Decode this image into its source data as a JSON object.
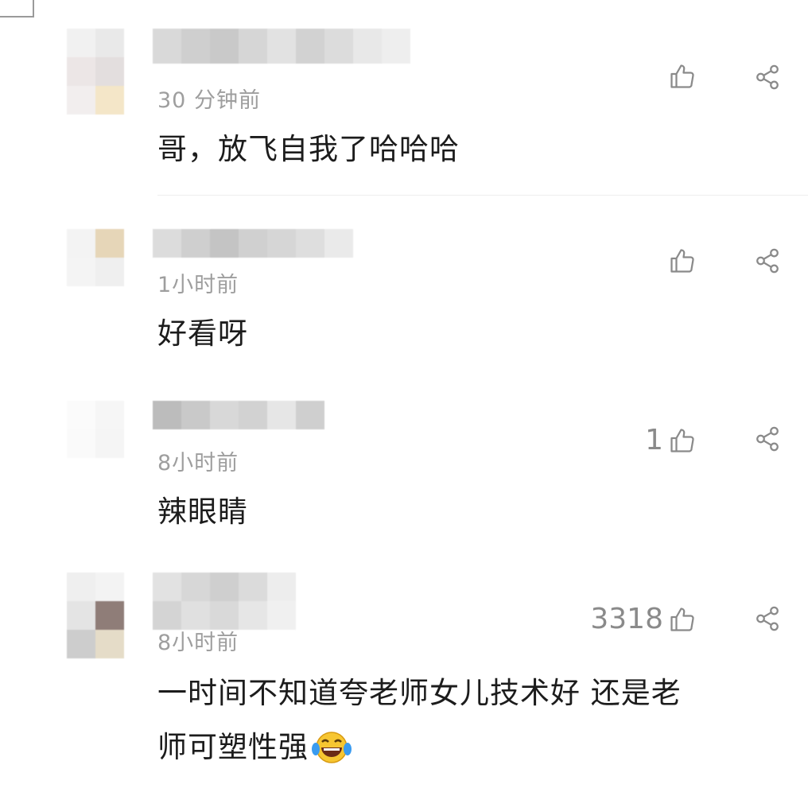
{
  "comments": [
    {
      "time": "30 分钟前",
      "text": "哥，放飞自我了哈哈哈",
      "likes": ""
    },
    {
      "time": "1小时前",
      "text": "好看呀",
      "likes": ""
    },
    {
      "time": "8小时前",
      "text": "辣眼睛",
      "likes": "1"
    },
    {
      "time": "8小时前",
      "text_line1": "一时间不知道夸老师女儿技术好 还是老",
      "text_line2": "师可塑性强",
      "likes": "3318"
    }
  ],
  "icons": {
    "like": "thumbs-up-icon",
    "share": "share-icon",
    "emoji": "laughing-tears-emoji"
  },
  "colors": {
    "meta_gray": "#9e9e9e",
    "text": "#1c1c1c",
    "icon_gray": "#8a8a8a"
  }
}
